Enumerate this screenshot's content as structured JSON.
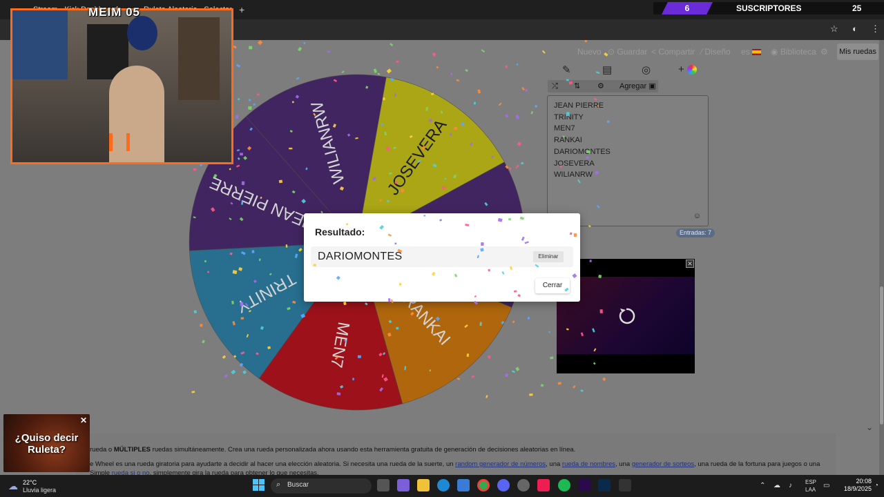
{
  "browser": {
    "tabs": [
      "Stream - Kick Dashboard",
      "Ruleta Aleatoria - Selector"
    ],
    "window_min": "–",
    "window_close": "✕"
  },
  "stream": {
    "cam_title": "MEIM 05",
    "subs_count": "6",
    "subs_label": "SUSCRIPTORES",
    "subs_goal": "25",
    "promo_text": "¿Quiso decir Ruleta?"
  },
  "site": {
    "nav": [
      "Nuevo",
      "Guardar",
      "Compartir",
      "Diseño",
      "es",
      "Biblioteca"
    ],
    "mis_ruedas": "Mis ruedas",
    "toolbar_add": "Agregar"
  },
  "wheel": {
    "segments": [
      {
        "label": "JOSEVERA",
        "color": "#c2bd1a"
      },
      {
        "label": "DARIOMONTES",
        "color": "#4a2b6e"
      },
      {
        "label": "RANKAI",
        "color": "#c8750e"
      },
      {
        "label": "MEN7",
        "color": "#b2141e"
      },
      {
        "label": "TRINITY",
        "color": "#2e7ea3"
      },
      {
        "label": "JEAN PIERRE",
        "color": "#4a2b6e"
      },
      {
        "label": "WILIANRW",
        "color": "#4a2b6e"
      }
    ]
  },
  "entries": {
    "items": [
      "JEAN PIERRE",
      "TRINITY",
      "MEN7",
      "RANKAI",
      "DARIOMONTES",
      "JOSEVERA",
      "WILIANRW"
    ],
    "count_label": "Entradas: 7"
  },
  "modal": {
    "title": "Resultado:",
    "winner": "DARIOMONTES",
    "remove_label": "Eliminar",
    "close_label": "Cerrar"
  },
  "article": {
    "line1_a": "rueda o ",
    "line1_b": "MÚLTIPLES",
    "line1_c": " ruedas simultáneamente. Crea una rueda personalizada ahora usando esta herramienta gratuita de generación de decisiones aleatorias en línea.",
    "line2_a": "e Wheel es una rueda giratoria para ayudarte a decidir al hacer una elección aleatoria. Si necesita una rueda de la suerte, un ",
    "link1": "random generador de números",
    "line2_b": ", una ",
    "link2": "rueda de nombres",
    "line2_c": ", una ",
    "link3": "generador de sorteos",
    "line2_d": ", una rueda de la fortuna para juegos o una",
    "line3_a": "Simple ",
    "link4": "rueda si o no",
    "line3_b": ", simplemente gira la rueda para obtener lo que necesitas."
  },
  "taskbar": {
    "weather_temp": "22°C",
    "weather_desc": "Lluvia ligera",
    "search_label": "Buscar",
    "lang_1": "ESP",
    "lang_2": "LAA",
    "time": "20:08",
    "date": "18/9/2025"
  }
}
